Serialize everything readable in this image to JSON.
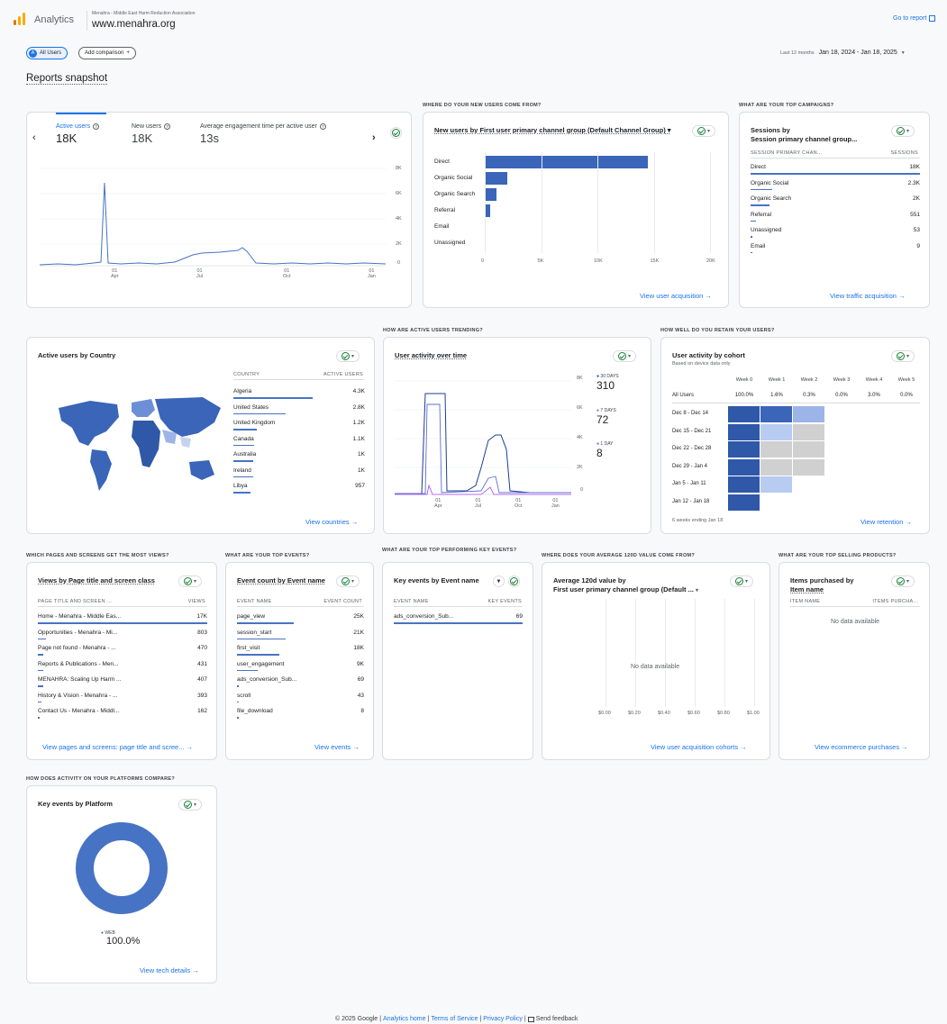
{
  "header": {
    "app_name": "Analytics",
    "account": "Menahra - Middle East Harm Reduction Association",
    "property": "www.menahra.org",
    "go_to_report": "Go to report"
  },
  "filters": {
    "all_users": "All Users",
    "add_comparison": "Add comparison",
    "date_label": "Last 12 months",
    "date_range": "Jan 18, 2024 - Jan 18, 2025"
  },
  "page_title": "Reports snapshot",
  "overview": {
    "metrics": [
      {
        "label": "Active users",
        "value": "18K"
      },
      {
        "label": "New users",
        "value": "18K"
      },
      {
        "label": "Average engagement time per active user",
        "value": "13s"
      }
    ],
    "y_ticks": [
      "8K",
      "6K",
      "4K",
      "2K",
      "0"
    ],
    "x_ticks": [
      {
        "d": "01",
        "m": "Apr"
      },
      {
        "d": "01",
        "m": "Jul"
      },
      {
        "d": "01",
        "m": "Oct"
      },
      {
        "d": "01",
        "m": "Jan"
      }
    ]
  },
  "acquisition": {
    "section": "WHERE DO YOUR NEW USERS COME FROM?",
    "title": "New users by First user primary channel group (Default Channel Group)",
    "chart_data": {
      "type": "bar",
      "orientation": "horizontal",
      "categories": [
        "Direct",
        "Organic Social",
        "Organic Search",
        "Referral",
        "Email",
        "Unassigned"
      ],
      "values": [
        14500,
        2000,
        1000,
        500,
        50,
        30
      ],
      "xlim": [
        0,
        20000
      ],
      "x_ticks": [
        "0",
        "5K",
        "10K",
        "15K",
        "20K"
      ]
    },
    "link": "View user acquisition"
  },
  "campaigns": {
    "section": "WHAT ARE YOUR TOP CAMPAIGNS?",
    "title_line1": "Sessions by",
    "title_line2": "Session primary channel group...",
    "col1": "SESSION PRIMARY CHAN...",
    "col2": "SESSIONS",
    "rows": [
      {
        "name": "Direct",
        "value": "18K",
        "frac": 1.0
      },
      {
        "name": "Organic Social",
        "value": "2.3K",
        "frac": 0.13
      },
      {
        "name": "Organic Search",
        "value": "2K",
        "frac": 0.11
      },
      {
        "name": "Referral",
        "value": "551",
        "frac": 0.03
      },
      {
        "name": "Unassigned",
        "value": "53",
        "frac": 0.01
      },
      {
        "name": "Email",
        "value": "9",
        "frac": 0.005
      }
    ],
    "link": "View traffic acquisition"
  },
  "country": {
    "title": "Active users by Country",
    "col1": "COUNTRY",
    "col2": "ACTIVE USERS",
    "rows": [
      {
        "name": "Algeria",
        "value": "4.3K",
        "frac": 0.6
      },
      {
        "name": "United States",
        "value": "2.8K",
        "frac": 0.4
      },
      {
        "name": "United Kingdom",
        "value": "1.2K",
        "frac": 0.18
      },
      {
        "name": "Canada",
        "value": "1.1K",
        "frac": 0.16
      },
      {
        "name": "Australia",
        "value": "1K",
        "frac": 0.15
      },
      {
        "name": "Ireland",
        "value": "1K",
        "frac": 0.15
      },
      {
        "name": "Libya",
        "value": "957",
        "frac": 0.13
      }
    ],
    "link": "View countries"
  },
  "trending": {
    "section": "HOW ARE ACTIVE USERS TRENDING?",
    "title": "User activity over time",
    "y_ticks": [
      "8K",
      "6K",
      "4K",
      "2K",
      "0"
    ],
    "legend": [
      {
        "label": "30 DAYS",
        "value": "310",
        "color": "#1a3f8f"
      },
      {
        "label": "7 DAYS",
        "value": "72",
        "color": "#5b6fd1"
      },
      {
        "label": "1 DAY",
        "value": "8",
        "color": "#a142f4"
      }
    ],
    "x_ticks": [
      {
        "d": "01",
        "m": "Apr"
      },
      {
        "d": "01",
        "m": "Jul"
      },
      {
        "d": "01",
        "m": "Oct"
      },
      {
        "d": "01",
        "m": "Jan"
      }
    ]
  },
  "retention": {
    "section": "HOW WELL DO YOU RETAIN YOUR USERS?",
    "title": "User activity by cohort",
    "subtitle": "Based on device data only",
    "weeks": [
      "Week 0",
      "Week 1",
      "Week 2",
      "Week 3",
      "Week 4",
      "Week 5"
    ],
    "all_label": "All Users",
    "all_values": [
      "100.0%",
      "1.6%",
      "0.3%",
      "0.0%",
      "3.0%",
      "0.0%"
    ],
    "cohorts": [
      "Dec 8 - Dec 14",
      "Dec 15 - Dec 21",
      "Dec 22 - Dec 28",
      "Dec 29 - Jan 4",
      "Jan 5 - Jan 11",
      "Jan 12 - Jan 18"
    ],
    "footer": "6 weeks ending Jan 18",
    "link": "View retention"
  },
  "pages": {
    "section": "WHICH PAGES AND SCREENS GET THE MOST VIEWS?",
    "title": "Views by Page title and screen class",
    "col1": "PAGE TITLE AND SCREEN ...",
    "col2": "VIEWS",
    "rows": [
      {
        "name": "Home - Menahra - Middle Eas...",
        "value": "17K",
        "frac": 1.0
      },
      {
        "name": "Opportunities - Menahra - Mi...",
        "value": "803",
        "frac": 0.05
      },
      {
        "name": "Page not found - Menahra - ...",
        "value": "470",
        "frac": 0.03
      },
      {
        "name": "Reports & Publications - Men...",
        "value": "431",
        "frac": 0.03
      },
      {
        "name": "MENAHRA: Scaling Up Harm ...",
        "value": "407",
        "frac": 0.03
      },
      {
        "name": "History & Vision - Menahra - ...",
        "value": "393",
        "frac": 0.02
      },
      {
        "name": "Contact Us - Menahra - Middl...",
        "value": "162",
        "frac": 0.01
      }
    ],
    "link": "View pages and screens: page title and scree..."
  },
  "events": {
    "section": "WHAT ARE YOUR TOP EVENTS?",
    "title": "Event count by Event name",
    "col1": "EVENT NAME",
    "col2": "EVENT COUNT",
    "rows": [
      {
        "name": "page_view",
        "value": "25K",
        "frac": 0.45
      },
      {
        "name": "session_start",
        "value": "21K",
        "frac": 0.38
      },
      {
        "name": "first_visit",
        "value": "18K",
        "frac": 0.33
      },
      {
        "name": "user_engagement",
        "value": "9K",
        "frac": 0.16
      },
      {
        "name": "ads_conversion_Sub...",
        "value": "69",
        "frac": 0.01
      },
      {
        "name": "scroll",
        "value": "43",
        "frac": 0.01
      },
      {
        "name": "file_download",
        "value": "8",
        "frac": 0.005
      }
    ],
    "link": "View events"
  },
  "key_events": {
    "section": "WHAT ARE YOUR TOP PERFORMING KEY EVENTS?",
    "title": "Key events by Event name",
    "col1": "EVENT NAME",
    "col2": "KEY EVENTS",
    "rows": [
      {
        "name": "ads_conversion_Sub...",
        "value": "69",
        "frac": 1.0
      }
    ]
  },
  "ltv": {
    "section": "WHERE DOES YOUR AVERAGE 120D VALUE COME FROM?",
    "title_line1": "Average 120d value by",
    "title_line2": "First user primary channel group (Default ...",
    "empty": "No data available",
    "x_ticks": [
      "$0.00",
      "$0.20",
      "$0.40",
      "$0.60",
      "$0.80",
      "$1.00"
    ],
    "link": "View user acquisition cohorts"
  },
  "products": {
    "section": "WHAT ARE YOUR TOP SELLING PRODUCTS?",
    "title_line1": "Items purchased by",
    "title_line2": "Item name",
    "col1": "ITEM NAME",
    "col2": "ITEMS PURCHA...",
    "empty": "No data available",
    "link": "View ecommerce purchases"
  },
  "platform": {
    "section": "HOW DOES ACTIVITY ON YOUR PLATFORMS COMPARE?",
    "title": "Key events by Platform",
    "chart_data": {
      "type": "pie",
      "categories": [
        "WEB"
      ],
      "values": [
        100.0
      ]
    },
    "legend_label": "WEB",
    "legend_value": "100.0%",
    "link": "View tech details"
  },
  "footer": {
    "copyright": "© 2025 Google",
    "links": [
      "Analytics home",
      "Terms of Service",
      "Privacy Policy"
    ],
    "feedback": "Send feedback"
  },
  "colors": {
    "accent": "#1a73e8",
    "bar": "#3a65b8",
    "orange": "#f9ab00",
    "green": "#188038"
  }
}
